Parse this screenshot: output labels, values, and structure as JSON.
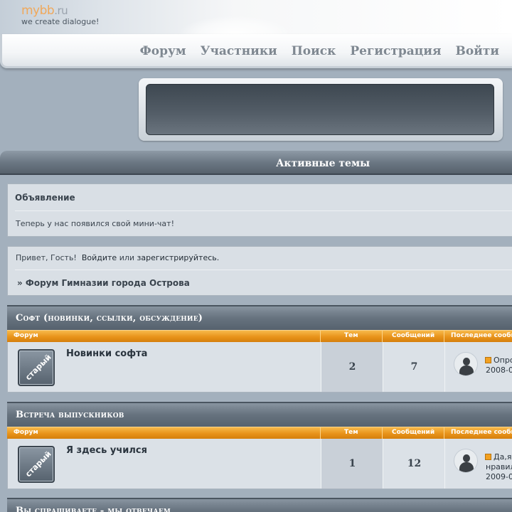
{
  "logo": {
    "main": "mybb",
    "domain": ".ru",
    "tagline": "we create dialogue!"
  },
  "nav": [
    "Форум",
    "Участники",
    "Поиск",
    "Регистрация",
    "Войти"
  ],
  "title_bar": "Активные темы",
  "announcement": {
    "title": "Объявление",
    "text": "Теперь у нас появился свой мини-чат!"
  },
  "welcome": {
    "greeting": "Привет, Гость!",
    "login": "Войдите",
    "or": "или",
    "register": "зарегистрируйтесь.",
    "breadcrumb": "» Форум Гимназии города Острова"
  },
  "columns": {
    "forum": "Форум",
    "topics": "Тем",
    "posts": "Сообщений",
    "last": "Последнее сообщение"
  },
  "categories": [
    {
      "title": "Софт (новинки, ссылки, обсуждение)",
      "forum": {
        "icon_label": "старый",
        "name": "Новинки софта",
        "topics": "2",
        "posts": "7",
        "last_line1": "Опро",
        "last_line2": "2008-0"
      }
    },
    {
      "title": "Встреча выпускников",
      "forum": {
        "icon_label": "старый",
        "name": "Я здесь учился",
        "topics": "1",
        "posts": "12",
        "last_line1": "Да,я",
        "last_line2": "нравил",
        "last_line3": "2009-0"
      }
    },
    {
      "title": "Вы спрашиваете - мы отвечаем"
    }
  ],
  "colors": {
    "accent_orange": "#e8931a",
    "header_slate": "#66727e",
    "panel_bg": "#d9dfe5"
  }
}
